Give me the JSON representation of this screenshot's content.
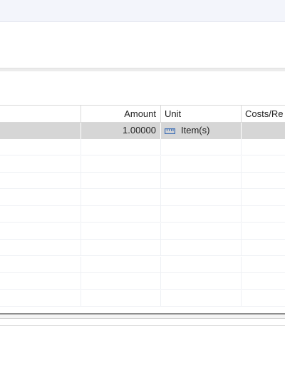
{
  "table": {
    "columns": [
      {
        "key": "a",
        "label": ""
      },
      {
        "key": "amount",
        "label": "Amount"
      },
      {
        "key": "unit",
        "label": "Unit"
      },
      {
        "key": "costs",
        "label": "Costs/Re"
      }
    ],
    "rows": [
      {
        "a": "",
        "amount": "1.00000",
        "unit": "Item(s)",
        "unit_icon": "unit-icon",
        "costs": "",
        "selected": true
      }
    ],
    "empty_rows": 10
  },
  "colors": {
    "selected_row": "#d6d6d6",
    "unit_icon": "#3f6fb5"
  }
}
